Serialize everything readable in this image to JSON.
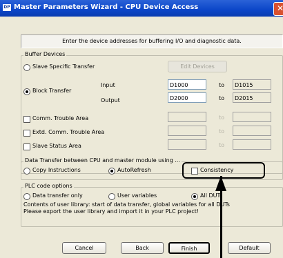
{
  "window": {
    "title": "Master Parameters Wizard - CPU Device Access",
    "app_icon_text": "DP",
    "close_glyph": "✕"
  },
  "info_text": "Enter the device addresses for buffering I/O and diagnostic data.",
  "buffer": {
    "group_label": "Buffer Devices",
    "slave_specific": "Slave Specific Transfer",
    "edit_devices": "Edit Devices",
    "block_transfer": "Block Transfer",
    "input_label": "Input",
    "output_label": "Output",
    "input_from": "D1000",
    "input_to": "D1015",
    "output_from": "D2000",
    "output_to": "D2015",
    "to_label": "to",
    "comm_trouble": "Comm. Trouble Area",
    "extd_comm_trouble": "Extd. Comm. Trouble Area",
    "slave_status": "Slave Status Area"
  },
  "transfer": {
    "group_label": "Data Transfer between CPU and master module using ...",
    "copy_instructions": "Copy Instructions",
    "autorefresh": "AutoRefresh",
    "consistency": "Consistency"
  },
  "plc": {
    "group_label": "PLC code options",
    "data_transfer_only": "Data transfer only",
    "user_variables": "User variables",
    "all_duts": "All DUTs",
    "note_line1": "Contents of user library: start of data transfer, global variables for all DUTs",
    "note_line2": "Please export the user library and import it in your PLC project!"
  },
  "buttons": {
    "cancel": "Cancel",
    "back": "Back",
    "finish": "Finish",
    "default": "Default"
  }
}
